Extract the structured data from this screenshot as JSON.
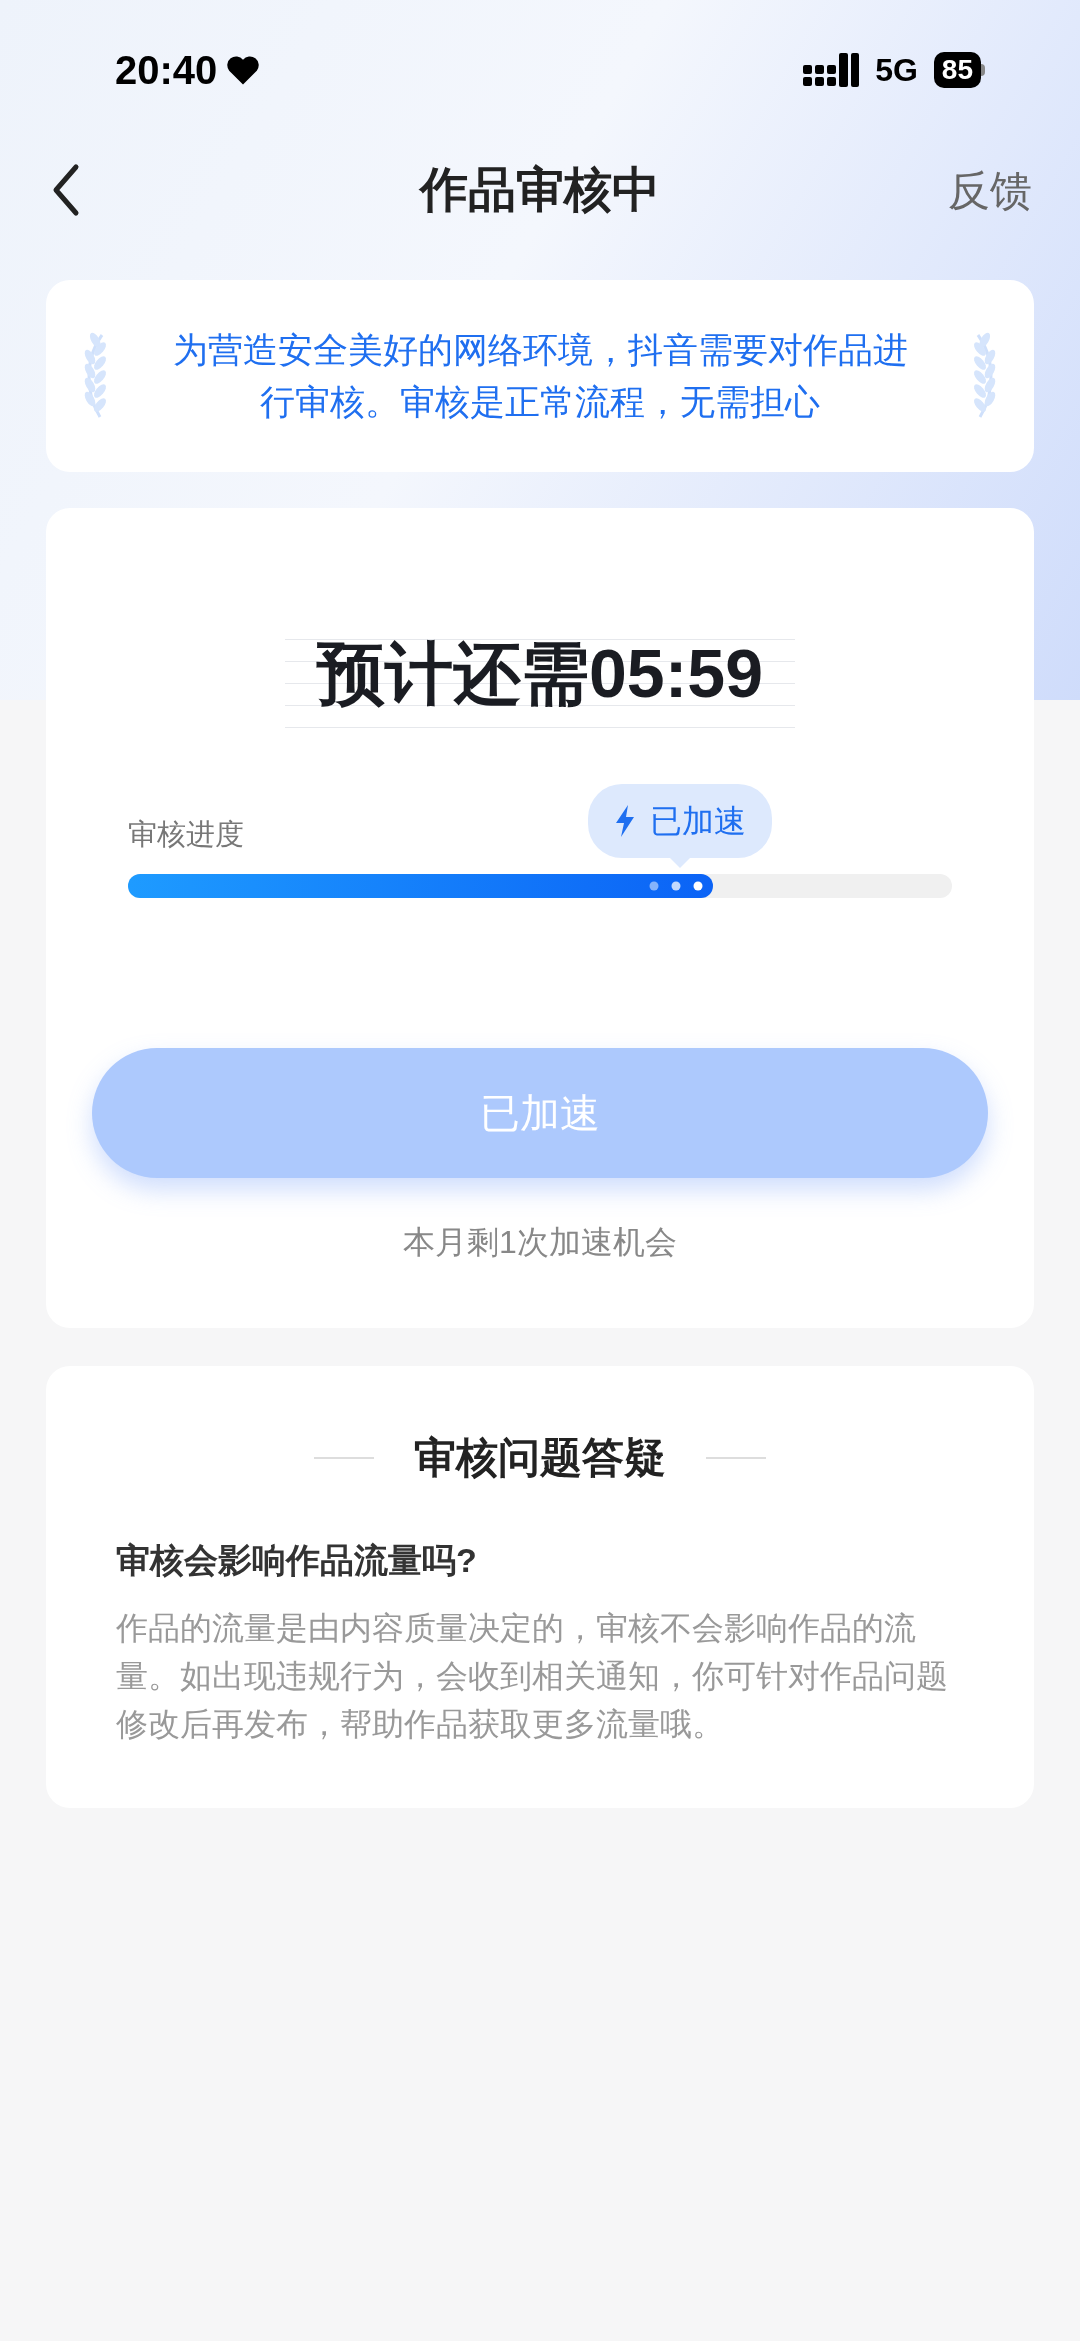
{
  "status_bar": {
    "time": "20:40",
    "network": "5G",
    "battery": "85"
  },
  "nav": {
    "title": "作品审核中",
    "action": "反馈"
  },
  "notice": {
    "text": "为营造安全美好的网络环境，抖音需要对作品进行审核。审核是正常流程，无需担心"
  },
  "review": {
    "countdown": "预计还需05:59",
    "progress_label": "审核进度",
    "badge": "已加速",
    "level": 0.71,
    "button": {
      "label": "已加速",
      "disabled": true
    },
    "hint": "本月剩1次加速机会"
  },
  "faq": {
    "title": "审核问题答疑",
    "items": [
      {
        "question": "审核会影响作品流量吗?",
        "answer": "作品的流量是由内容质量决定的，审核不会影响作品的流量。如出现违规行为，会收到相关通知，你可针对作品问题修改后再发布，帮助作品获取更多流量哦。"
      }
    ]
  }
}
